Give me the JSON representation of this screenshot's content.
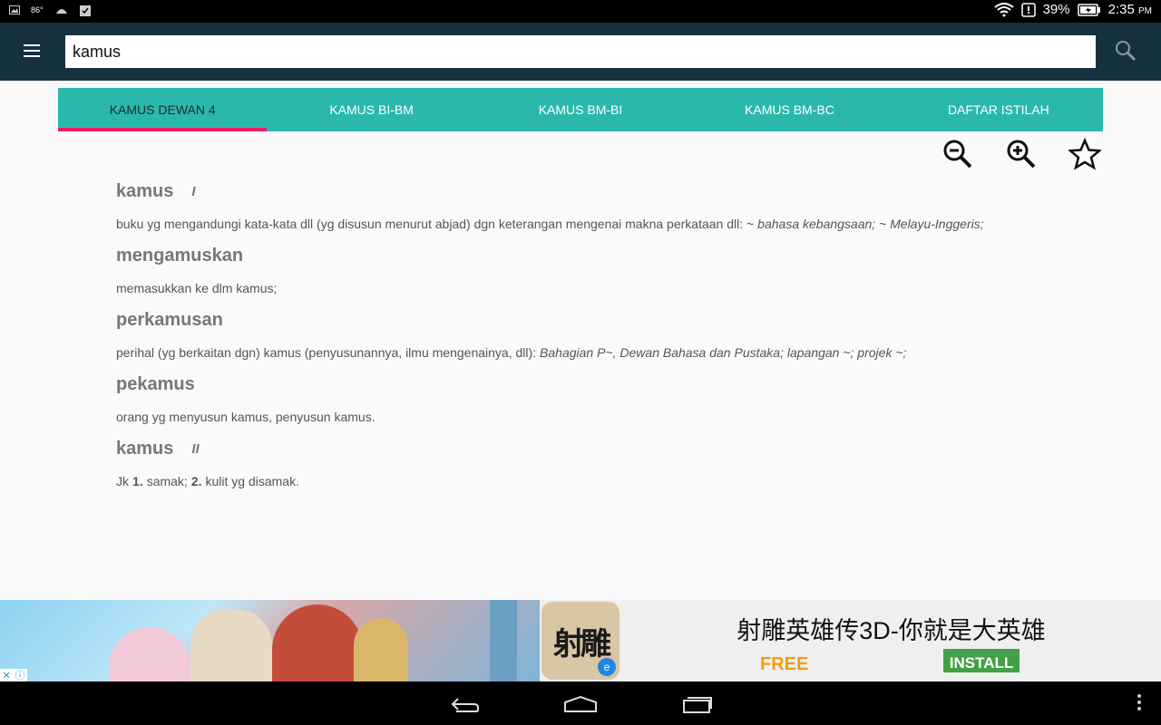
{
  "status_bar": {
    "temperature": "86°",
    "battery": "39%",
    "time": "2:35",
    "ampm": "PM"
  },
  "search": {
    "value": "kamus",
    "placeholder": ""
  },
  "tabs": [
    {
      "label": "KAMUS DEWAN 4",
      "active": true
    },
    {
      "label": "KAMUS BI-BM",
      "active": false
    },
    {
      "label": "KAMUS BM-BI",
      "active": false
    },
    {
      "label": "KAMUS BM-BC",
      "active": false
    },
    {
      "label": "DAFTAR ISTILAH",
      "active": false
    }
  ],
  "toolbar": {
    "icons": [
      "zoom-out-icon",
      "zoom-in-icon",
      "star-icon"
    ]
  },
  "entries": [
    {
      "headword": "kamus",
      "number": "I",
      "definition": "buku yg mengandungi kata-kata dll (yg disusun menurut abjad) dgn keterangan mengenai makna perkataan dll: ~",
      "example": "bahasa kebangsaan; ~ Melayu-Inggeris;"
    },
    {
      "headword": "mengamuskan",
      "number": "",
      "definition": "memasukkan ke dlm kamus;",
      "example": ""
    },
    {
      "headword": "perkamusan",
      "number": "",
      "definition": "perihal (yg berkaitan dgn) kamus (penyusunannya, ilmu mengenainya, dll):",
      "example": "Bahagian P~, Dewan Bahasa dan Pustaka; lapangan ~; projek ~;"
    },
    {
      "headword": "pekamus",
      "number": "",
      "definition": "orang yg menyusun kamus, penyusun kamus.",
      "example": ""
    },
    {
      "headword": "kamus",
      "number": "II",
      "definition_parts": {
        "prefix": "Jk",
        "n1": "1.",
        "t1": "samak;",
        "n2": "2.",
        "t2": "kulit yg disamak."
      }
    }
  ],
  "ad": {
    "logo_text": "射雕",
    "title": "射雕英雄传3D-你就是大英雄",
    "free_label": "FREE",
    "install_label": "INSTALL"
  },
  "colors": {
    "appbar": "#17323f",
    "tabs": "#2bb8ac",
    "tab_indicator": "#e91e63"
  }
}
